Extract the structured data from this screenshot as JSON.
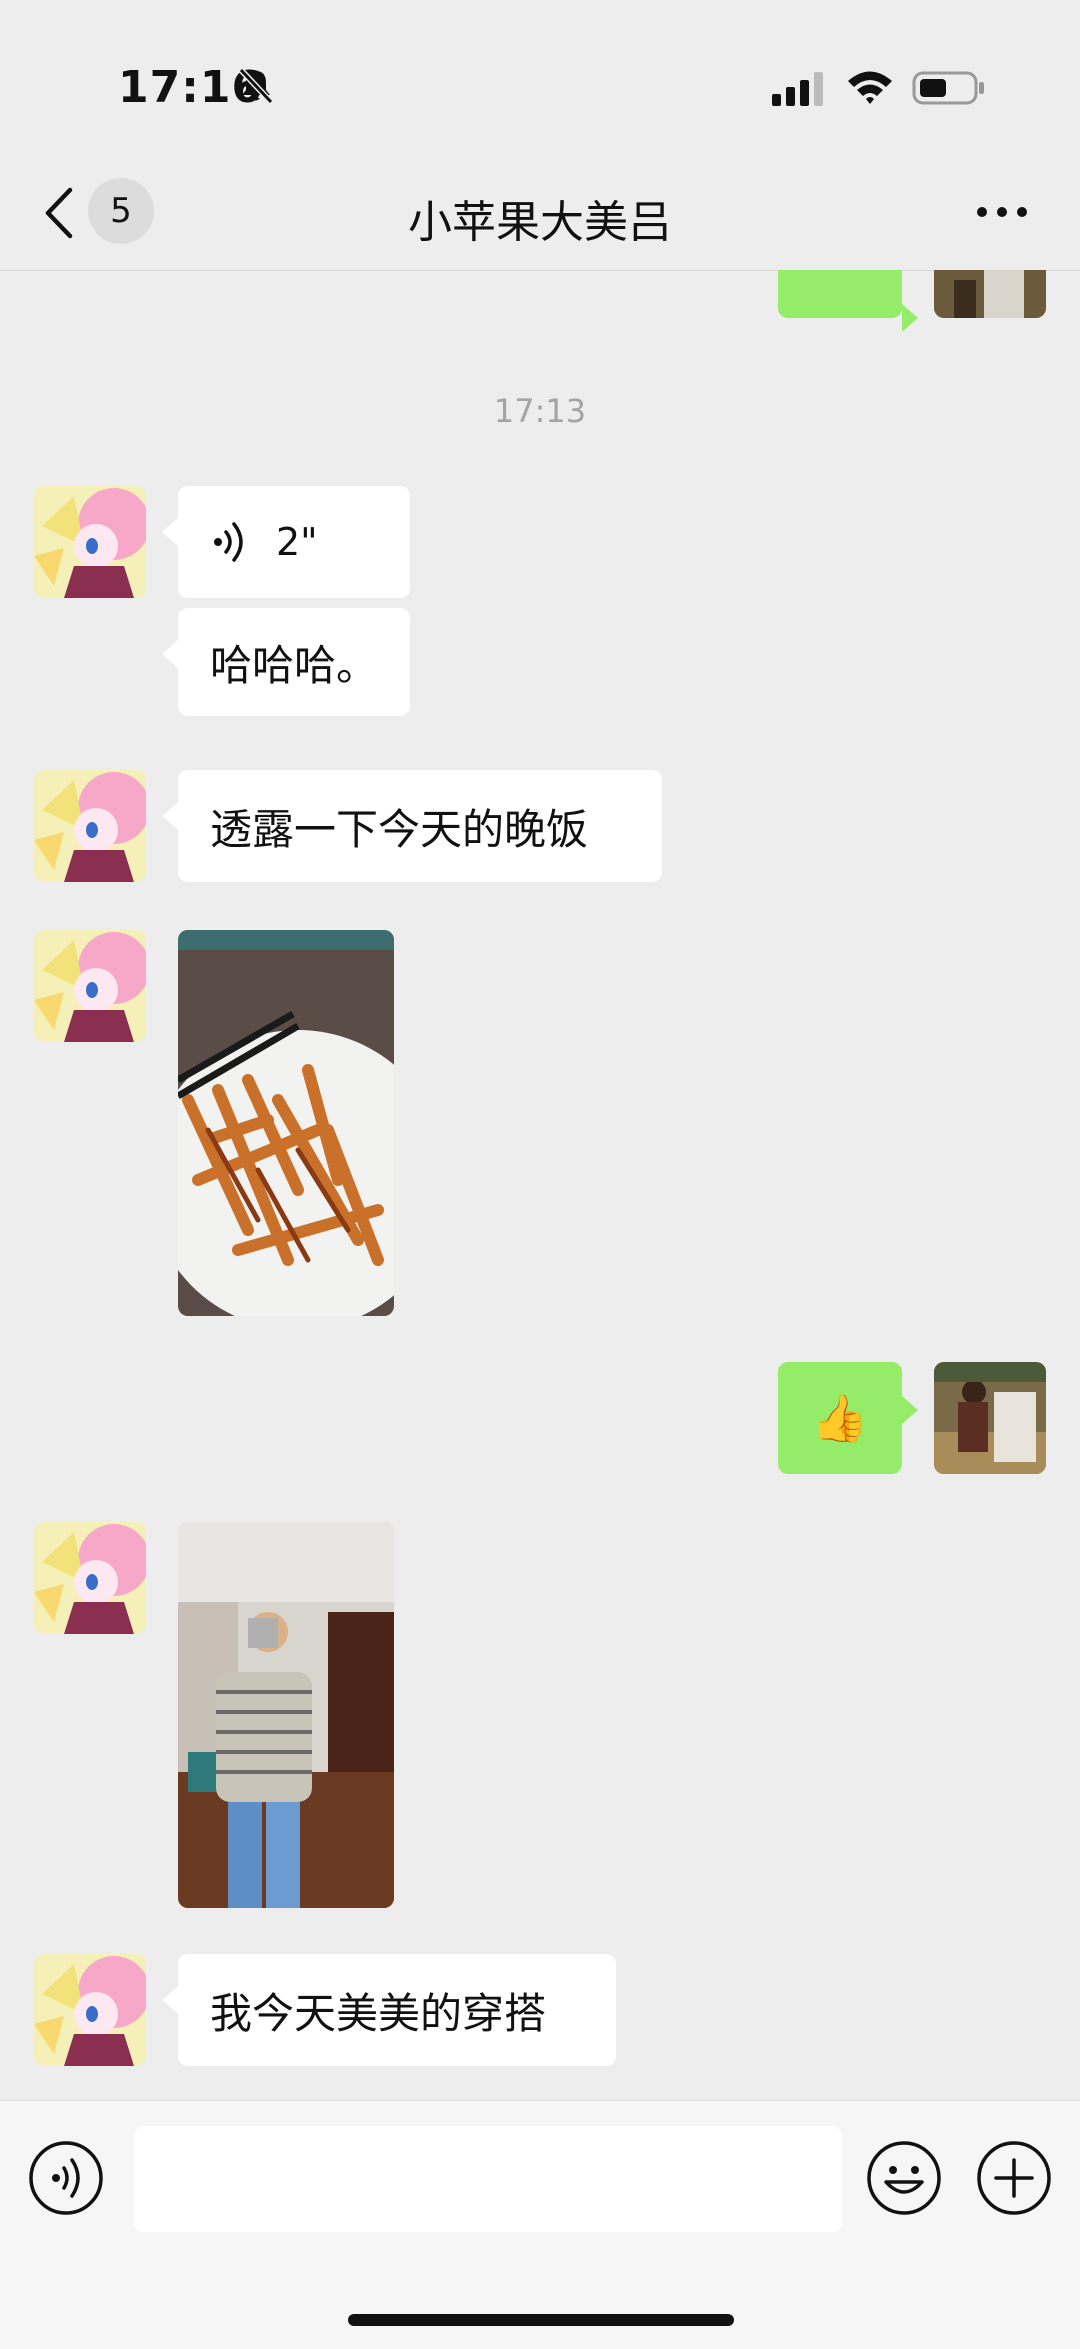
{
  "status_bar": {
    "time": "17:16",
    "signal_icon": "cellular-signal-icon",
    "wifi_icon": "wifi-icon",
    "battery_icon": "battery-icon",
    "mute_icon": "bell-slash-icon"
  },
  "nav": {
    "back_icon": "chevron-left-icon",
    "unread_count": "5",
    "title": "小苹果大美吕",
    "more_icon": "ellipsis-icon"
  },
  "messages": {
    "timestamp": "17:13",
    "voice_duration": "2\"",
    "text_1": "哈哈哈。",
    "text_2": "透露一下今天的晚饭",
    "photo_1": "dinner-photo",
    "reply_emoji": "👍",
    "photo_2": "outfit-selfie-photo",
    "text_3": "我今天美美的穿搭"
  },
  "input_bar": {
    "voice_icon": "voice-icon",
    "emoji_icon": "smiley-icon",
    "plus_icon": "plus-circle-icon"
  },
  "colors": {
    "background": "#ededed",
    "incoming_bubble": "#ffffff",
    "outgoing_bubble": "#95ec69",
    "timestamp": "#a4a4a4"
  }
}
